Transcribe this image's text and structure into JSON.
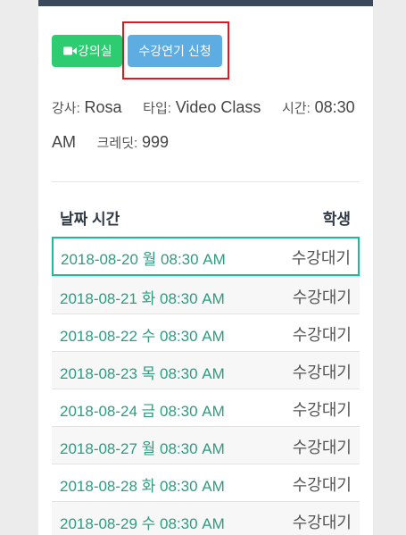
{
  "buttons": {
    "classroom_label": "강의실",
    "extend_label": "수강연기 신청"
  },
  "info": {
    "teacher_label": "강사:",
    "teacher_value": "Rosa",
    "type_label": "타입:",
    "type_value": "Video Class",
    "time_label": "시간:",
    "time_value": "08:30",
    "time_suffix": "AM",
    "credit_label": "크레딧:",
    "credit_value": "999"
  },
  "table": {
    "headers": {
      "date": "날짜 시간",
      "student": "학생"
    },
    "rows": [
      {
        "date": "2018-08-20 월 08:30 AM",
        "status": "수강대기"
      },
      {
        "date": "2018-08-21 화 08:30 AM",
        "status": "수강대기"
      },
      {
        "date": "2018-08-22 수 08:30 AM",
        "status": "수강대기"
      },
      {
        "date": "2018-08-23 목 08:30 AM",
        "status": "수강대기"
      },
      {
        "date": "2018-08-24 금 08:30 AM",
        "status": "수강대기"
      },
      {
        "date": "2018-08-27 월 08:30 AM",
        "status": "수강대기"
      },
      {
        "date": "2018-08-28 화 08:30 AM",
        "status": "수강대기"
      },
      {
        "date": "2018-08-29 수 08:30 AM",
        "status": "수강대기"
      }
    ]
  },
  "colors": {
    "classroom_button": "#2ecc71",
    "extend_button": "#5dade2",
    "highlight": "#e8141a",
    "date_text": "#2e9c7e",
    "selected_row_border": "#1abc9c"
  },
  "icons": {
    "classroom_icon": "video-camera-icon"
  }
}
